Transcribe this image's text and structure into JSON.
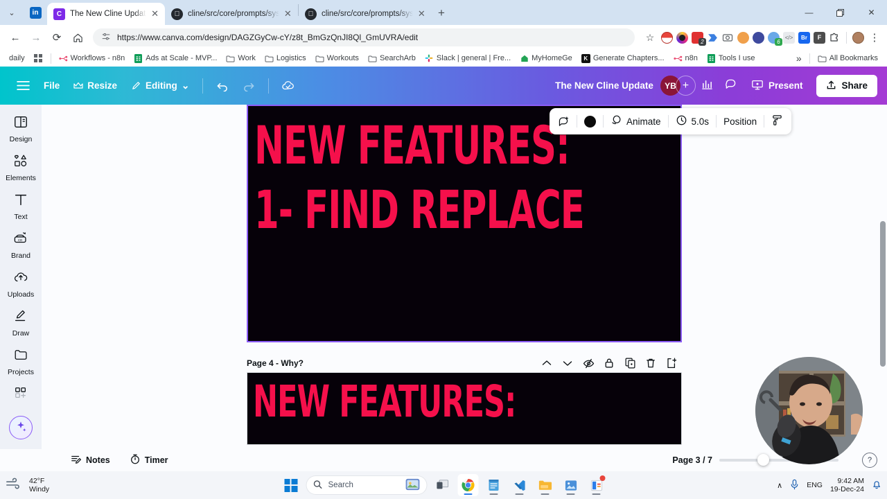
{
  "browser": {
    "tabs": [
      {
        "title": "The New Cline Update - Presen",
        "favicon": "canva-icon",
        "active": true
      },
      {
        "title": "cline/src/core/prompts/system",
        "favicon": "github-icon",
        "active": false
      },
      {
        "title": "cline/src/core/prompts/system",
        "favicon": "github-icon",
        "active": false
      }
    ],
    "new_tab_label": "+",
    "close_label": "✕",
    "tablist_chevron": "⌄",
    "window_controls": {
      "minimize": "—",
      "maximize": "❐",
      "close": "✕"
    },
    "nav": {
      "back": "←",
      "forward": "→",
      "reload": "⟳",
      "home": "⌂"
    },
    "omnibox": {
      "url": "https://www.canva.com/design/DAGZGyCw-cY/z8t_BmGzQnJI8Ql_GmUVRA/edit",
      "site_info_icon": "tune-icon",
      "bookmark_star": "☆"
    },
    "extensions": [
      {
        "name": "pokeball-extension",
        "color": "#e8453c",
        "badge": null
      },
      {
        "name": "instagram-extension",
        "color": "#c13584",
        "badge": null
      },
      {
        "name": "red-notes-extension",
        "color": "#e03131",
        "badge": "2"
      },
      {
        "name": "power-automate-extension",
        "color": "#3b7fe0",
        "badge": null
      },
      {
        "name": "screenshot-extension",
        "color": "#5f6368",
        "badge": null
      },
      {
        "name": "santa-extension",
        "color": "#f0a04b",
        "badge": null
      },
      {
        "name": "alien-extension",
        "color": "#3e4a9e",
        "badge": null
      },
      {
        "name": "loom-extension",
        "color": "#5b8def",
        "badge": "6"
      },
      {
        "name": "code-extension",
        "color": "#9aa0a6",
        "badge": null
      },
      {
        "name": "bardeen-extension",
        "color": "#1767ef",
        "badge": null
      },
      {
        "name": "f-extension",
        "color": "#4d4d4d",
        "badge": null
      },
      {
        "name": "puzzle-extension",
        "color": "#ffffff",
        "badge": null
      }
    ],
    "profile_label": "profile-avatar",
    "menu_label": "⋮",
    "bookmarks": [
      {
        "label": "daily",
        "icon": "text-only",
        "color": "#5f6368"
      },
      {
        "label": "",
        "icon": "apps-grid-icon",
        "color": "#5f6368"
      },
      {
        "label": "Workflows - n8n",
        "icon": "n8n-icon",
        "color": "#ea4b71"
      },
      {
        "label": "Ads at Scale - MVP...",
        "icon": "sheets-icon",
        "color": "#0f9d58"
      },
      {
        "label": "Work",
        "icon": "folder-icon",
        "color": "#5f6368"
      },
      {
        "label": "Logistics",
        "icon": "folder-icon",
        "color": "#5f6368"
      },
      {
        "label": "Workouts",
        "icon": "folder-icon",
        "color": "#5f6368"
      },
      {
        "label": "SearchArb",
        "icon": "folder-icon",
        "color": "#5f6368"
      },
      {
        "label": "Slack | general | Fre...",
        "icon": "slack-icon",
        "color": "#e01e5a"
      },
      {
        "label": "MyHomeGe",
        "icon": "home-icon",
        "color": "#23a455"
      },
      {
        "label": "Generate Chapters...",
        "icon": "k-icon",
        "color": "#111111"
      },
      {
        "label": "n8n",
        "icon": "n8n-icon",
        "color": "#ea4b71"
      },
      {
        "label": "Tools I use",
        "icon": "sheets-icon",
        "color": "#0f9d58"
      }
    ],
    "bookmarks_overflow": "»",
    "all_bookmarks_label": "All Bookmarks",
    "all_bookmarks_icon": "folder-icon"
  },
  "canva": {
    "header": {
      "menu_icon": "hamburger-icon",
      "file_label": "File",
      "resize_label": "Resize",
      "resize_icon": "crown-icon",
      "editing_label": "Editing",
      "editing_icon": "pencil-icon",
      "editing_chevron": "⌄",
      "undo_icon": "undo-icon",
      "redo_icon": "redo-icon",
      "cloud_icon": "cloud-saved-icon",
      "doc_title": "The New Cline Update",
      "avatar_initials": "YB",
      "invite_plus": "+",
      "insights_icon": "bar-chart-icon",
      "comment_icon": "comment-icon",
      "present_label": "Present",
      "present_icon": "presentation-icon",
      "share_label": "Share",
      "share_icon": "upload-icon"
    },
    "sidebar": [
      {
        "label": "Design",
        "icon": "design-panel-icon"
      },
      {
        "label": "Elements",
        "icon": "elements-shapes-icon"
      },
      {
        "label": "Text",
        "icon": "text-t-icon"
      },
      {
        "label": "Brand",
        "icon": "brand-kit-icon"
      },
      {
        "label": "Uploads",
        "icon": "upload-cloud-icon"
      },
      {
        "label": "Draw",
        "icon": "draw-pen-icon"
      },
      {
        "label": "Projects",
        "icon": "projects-folder-icon"
      },
      {
        "label": "",
        "icon": "apps-plus-icon"
      }
    ],
    "sidebar_ai_icon": "magic-sparkle-icon",
    "element_toolbar": {
      "effects_icon": "add-comment-icon",
      "color_swatch": "#0b0b0b",
      "color_label": "color-swatch",
      "animate_label": "Animate",
      "animate_icon": "animate-icon",
      "duration_label": "5.0s",
      "duration_icon": "clock-icon",
      "position_label": "Position",
      "more_icon": "paint-roller-icon"
    },
    "slide_current": {
      "line1": "NEW FEATURES:",
      "line2": "1- FIND REPLACE",
      "text_color": "#F5104B",
      "background": "#060109"
    },
    "page_row": {
      "title": "Page 4 - Why?",
      "icons": [
        {
          "name": "move-up-icon",
          "glyph": "∧"
        },
        {
          "name": "move-down-icon",
          "glyph": "∨"
        },
        {
          "name": "hide-page-icon",
          "glyph": "hide"
        },
        {
          "name": "lock-page-icon",
          "glyph": "lock"
        },
        {
          "name": "duplicate-page-icon",
          "glyph": "dup"
        },
        {
          "name": "delete-page-icon",
          "glyph": "trash"
        },
        {
          "name": "expand-page-icon",
          "glyph": "expand"
        }
      ]
    },
    "slide_next": {
      "line1": "NEW FEATURES:",
      "text_color": "#F5104B",
      "background": "#060109"
    },
    "footer": {
      "notes_label": "Notes",
      "notes_icon": "notes-icon",
      "timer_label": "Timer",
      "timer_icon": "timer-icon",
      "page_indicator": "Page 3 / 7",
      "help_label": "?",
      "help_icon": "help-icon"
    }
  },
  "taskbar": {
    "weather": {
      "temp": "42°F",
      "condition": "Windy",
      "icon": "windy-icon"
    },
    "start_label": "start-button",
    "search_placeholder": "Search",
    "search_icon": "search-icon",
    "search_image_icon": "search-illustration-icon",
    "apps": [
      {
        "name": "taskview-icon",
        "color": "#c8ccd4"
      },
      {
        "name": "chrome-icon",
        "color": "#ffffff",
        "active": true
      },
      {
        "name": "notepad-icon",
        "color": "#4aa3df"
      },
      {
        "name": "vscode-icon",
        "color": "#2b88d8"
      },
      {
        "name": "file-explorer-icon",
        "color": "#f7b733"
      },
      {
        "name": "photos-icon",
        "color": "#4a90d9"
      },
      {
        "name": "office-icon",
        "color": "#d83b01",
        "badge": true
      }
    ],
    "tray": {
      "chevron": "∧",
      "mic_icon": "microphone-icon",
      "language": "ENG",
      "time": "9:42 AM",
      "date": "19-Dec-24",
      "bell_icon": "notification-bell-icon"
    }
  }
}
